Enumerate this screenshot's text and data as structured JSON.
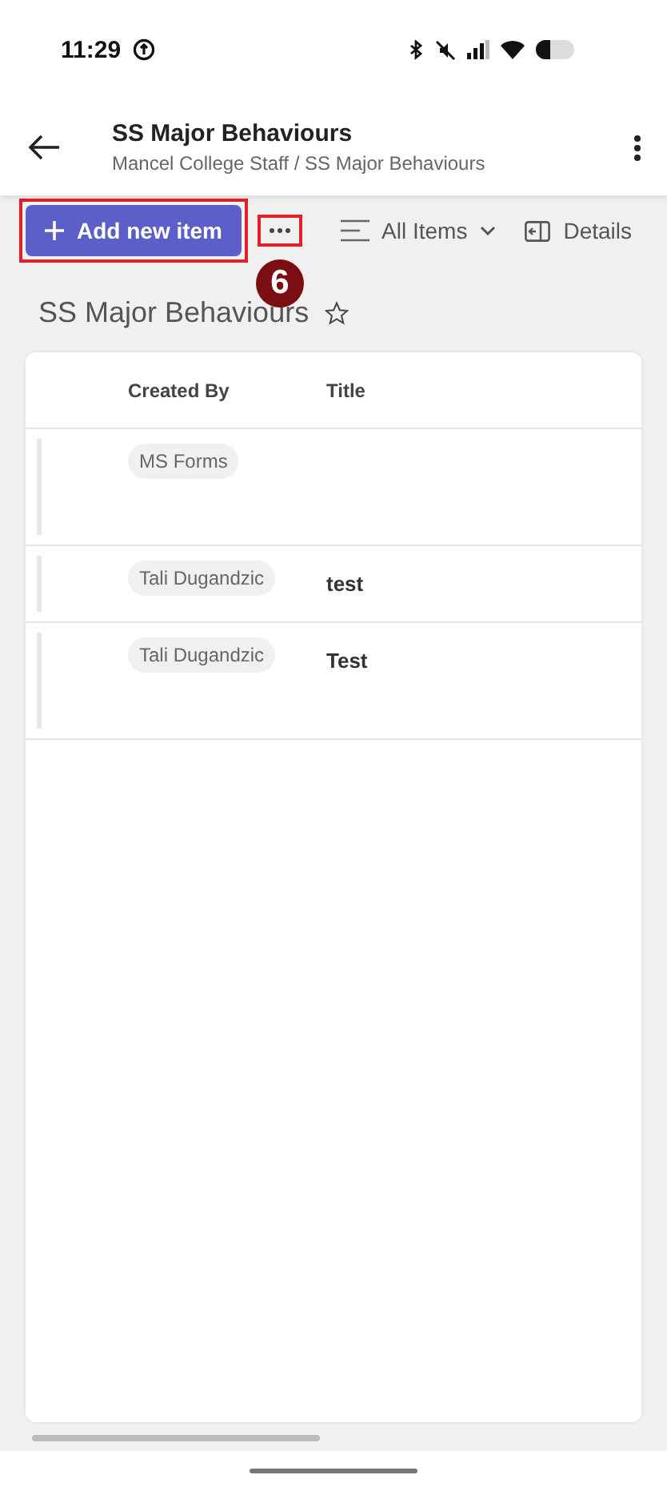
{
  "status_bar": {
    "time": "11:29"
  },
  "header": {
    "title": "SS Major Behaviours",
    "breadcrumb": "Mancel College Staff / SS Major Behaviours"
  },
  "toolbar": {
    "add_button": "Add new item",
    "view": "All Items",
    "details": "Details"
  },
  "annotation": {
    "number": "6"
  },
  "list": {
    "title": "SS Major Behaviours",
    "favorite": false,
    "columns": [
      "Created By",
      "Title"
    ],
    "rows": [
      {
        "created_by": "MS Forms",
        "tall": true
      },
      {
        "created_by": "Tali Dugandzic",
        "title": "test",
        "tall": false
      },
      {
        "created_by": "Tali Dugandzic",
        "title": "Test",
        "tall": true
      }
    ]
  }
}
